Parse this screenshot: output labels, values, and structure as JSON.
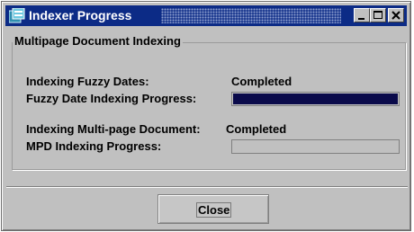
{
  "window": {
    "title": "Indexer Progress",
    "icon": "app-icon",
    "controls": [
      "minimize-icon",
      "maximize-icon",
      "close-icon"
    ]
  },
  "group": {
    "title": "Multipage Document Indexing",
    "rows": [
      {
        "label": "Indexing Fuzzy Dates:",
        "value": "Completed"
      },
      {
        "label": "Fuzzy Date Indexing Progress:",
        "progress": 1.0
      },
      {
        "label": "Indexing Multi-page Document:",
        "value": "Completed"
      },
      {
        "label": "MPD Indexing Progress:",
        "progress": 0.0
      }
    ]
  },
  "footer": {
    "close_label": "Close"
  },
  "colors": {
    "titlebar": "#0c2b86",
    "progress_fill": "#0a0a4a",
    "window_bg": "#c0c0c0"
  }
}
